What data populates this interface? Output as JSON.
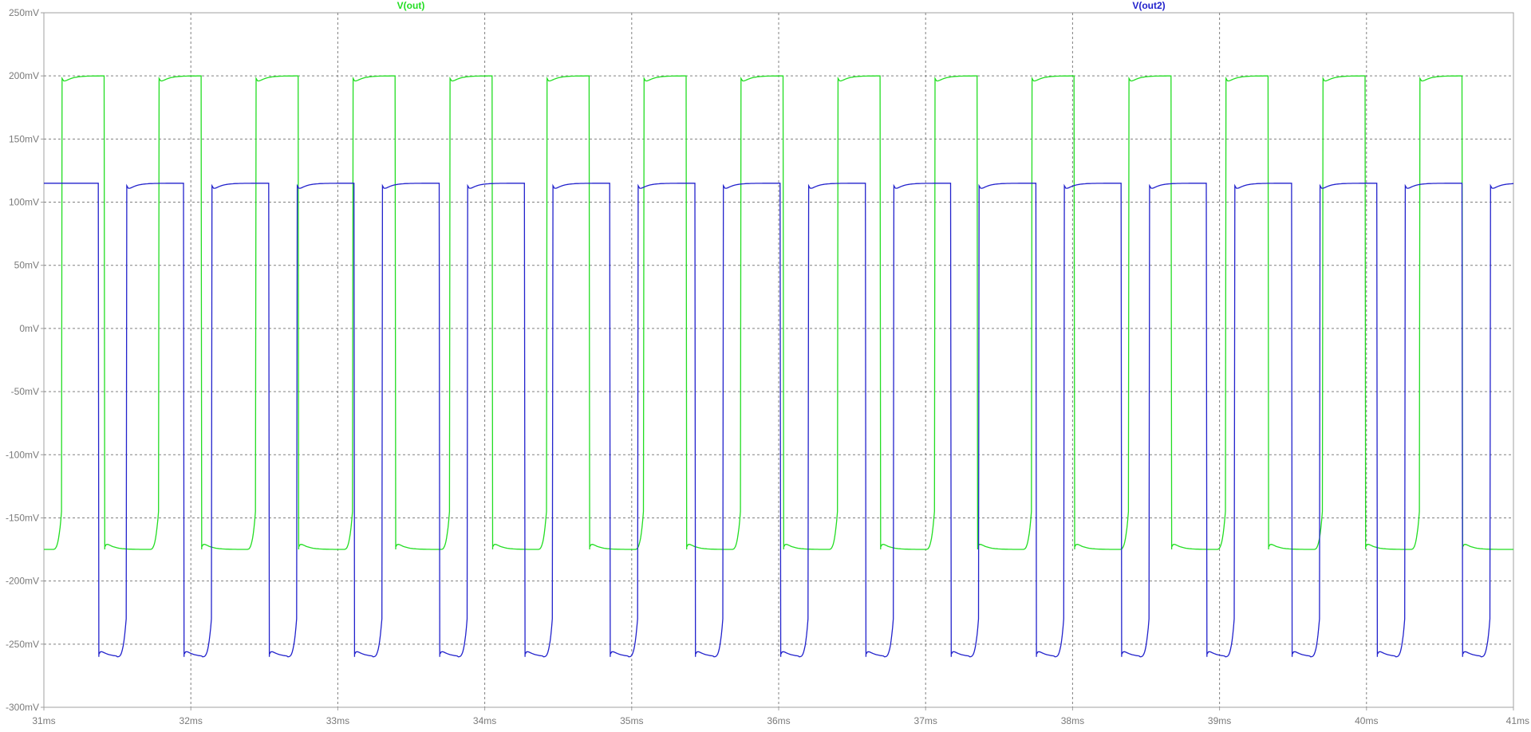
{
  "chart_data": {
    "type": "line",
    "title": "",
    "xlabel": "",
    "ylabel": "",
    "xlim": [
      31,
      41
    ],
    "ylim": [
      -300,
      250
    ],
    "grid": true,
    "x_ticks": [
      {
        "value": 31,
        "label": "31ms"
      },
      {
        "value": 32,
        "label": "32ms"
      },
      {
        "value": 33,
        "label": "33ms"
      },
      {
        "value": 34,
        "label": "34ms"
      },
      {
        "value": 35,
        "label": "35ms"
      },
      {
        "value": 36,
        "label": "36ms"
      },
      {
        "value": 37,
        "label": "37ms"
      },
      {
        "value": 38,
        "label": "38ms"
      },
      {
        "value": 39,
        "label": "39ms"
      },
      {
        "value": 40,
        "label": "40ms"
      },
      {
        "value": 41,
        "label": "41ms"
      }
    ],
    "y_ticks": [
      {
        "value": 250,
        "label": "250mV"
      },
      {
        "value": 200,
        "label": "200mV"
      },
      {
        "value": 150,
        "label": "150mV"
      },
      {
        "value": 100,
        "label": "100mV"
      },
      {
        "value": 50,
        "label": "50mV"
      },
      {
        "value": 0,
        "label": "0mV"
      },
      {
        "value": -50,
        "label": "-50mV"
      },
      {
        "value": -100,
        "label": "-100mV"
      },
      {
        "value": -150,
        "label": "-150mV"
      },
      {
        "value": -200,
        "label": "-200mV"
      },
      {
        "value": -250,
        "label": "-250mV"
      },
      {
        "value": -300,
        "label": "-300mV"
      }
    ],
    "series": [
      {
        "name": "V(out)",
        "color": "#22dd22",
        "high_mV": 200,
        "low_mV": -175,
        "period_ms": 0.66,
        "rise_ms": [
          31.12,
          31.78,
          32.44,
          33.1,
          33.76,
          34.42,
          35.08,
          35.74,
          36.4,
          37.06,
          37.72,
          38.38,
          39.04,
          39.7,
          40.36
        ],
        "fall_ms": [
          31.41,
          32.07,
          32.73,
          33.39,
          34.05,
          34.71,
          35.37,
          36.03,
          36.69,
          37.35,
          38.01,
          38.67,
          39.33,
          39.99,
          40.65
        ]
      },
      {
        "name": "V(out2)",
        "color": "#2222cc",
        "high_mV": 115,
        "low_mV": -260,
        "period_ms": 0.58,
        "rise_ms": [
          31.56,
          32.14,
          32.72,
          33.3,
          33.88,
          34.46,
          35.04,
          35.62,
          36.2,
          36.78,
          37.36,
          37.94,
          38.52,
          39.1,
          39.68,
          40.26,
          40.84
        ],
        "fall_ms": [
          31.37,
          31.95,
          32.53,
          33.11,
          33.69,
          34.27,
          34.85,
          35.43,
          36.01,
          36.59,
          37.17,
          37.75,
          38.33,
          38.91,
          39.49,
          40.07,
          40.65
        ]
      }
    ]
  }
}
